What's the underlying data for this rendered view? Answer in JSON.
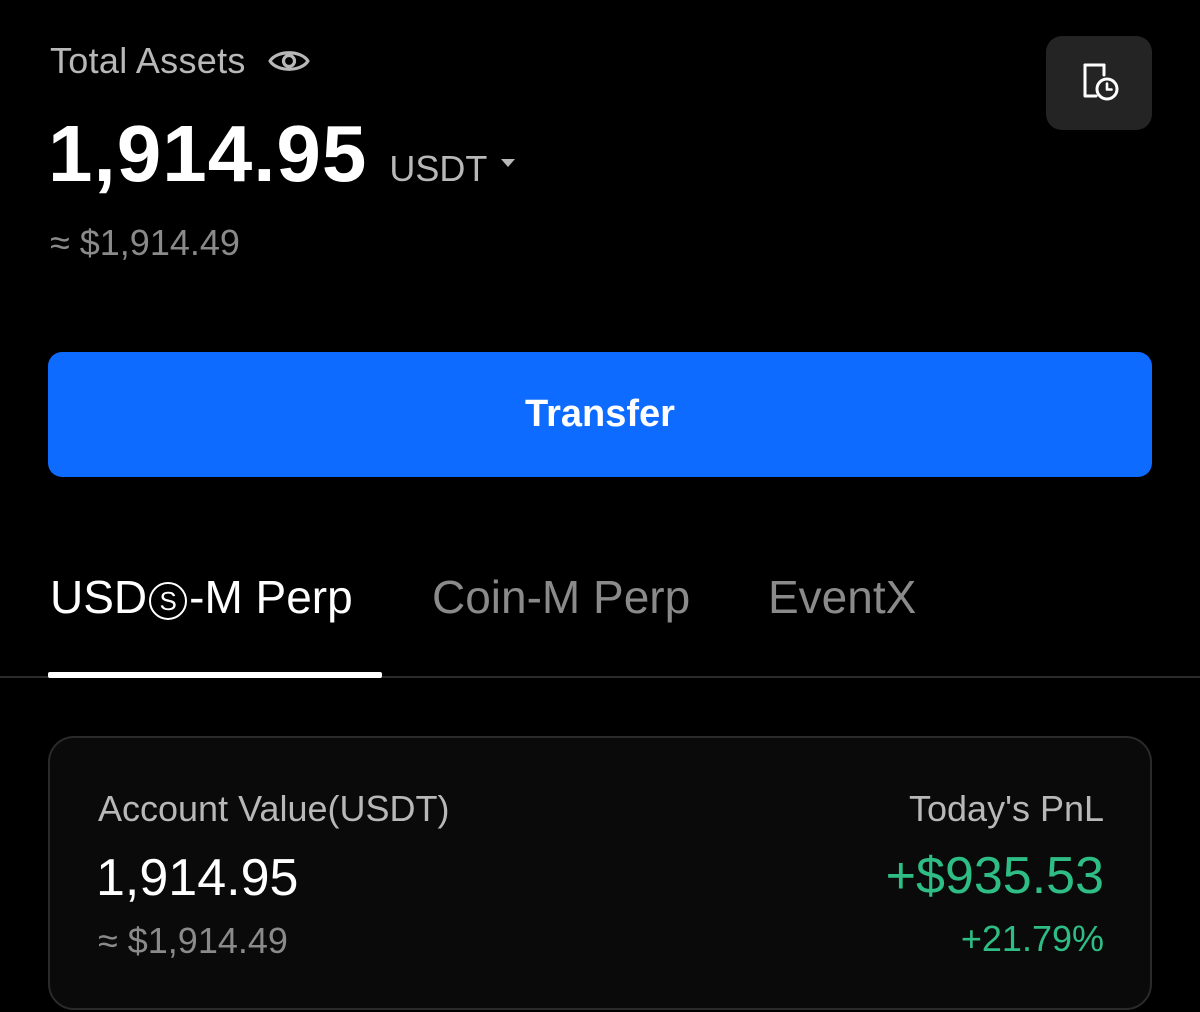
{
  "header": {
    "assets_label": "Total Assets",
    "total_value": "1,914.95",
    "currency": "USDT",
    "approx_usd": "≈ $1,914.49"
  },
  "actions": {
    "transfer_label": "Transfer"
  },
  "tabs": [
    {
      "pre": "USD",
      "circle": "S",
      "post": "-M Perp",
      "active": true
    },
    {
      "label": "Coin-M Perp",
      "active": false
    },
    {
      "label": "EventX",
      "active": false
    }
  ],
  "account": {
    "value_label": "Account Value(USDT)",
    "value": "1,914.95",
    "approx_usd": "≈ $1,914.49",
    "pnl_label": "Today's PnL",
    "pnl_value": "+$935.53",
    "pnl_percent": "+21.79%"
  },
  "colors": {
    "background": "#000000",
    "accent_blue": "#0e6bff",
    "positive_green": "#2ebd85",
    "card_border": "#2a2a2a"
  },
  "icons": {
    "visibility": "eye-icon",
    "history": "history-clock-icon",
    "currency_dropdown": "caret-down-icon"
  }
}
